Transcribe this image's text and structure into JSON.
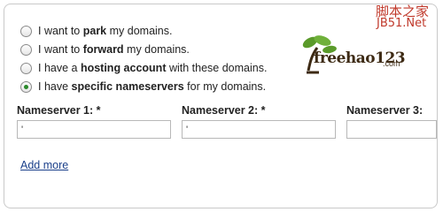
{
  "options": [
    {
      "prefix": "I want to ",
      "bold": "park",
      "suffix": " my domains.",
      "checked": false
    },
    {
      "prefix": "I want to ",
      "bold": "forward",
      "suffix": " my domains.",
      "checked": false
    },
    {
      "prefix": "I have a ",
      "bold": "hosting account",
      "suffix": " with these domains.",
      "checked": false
    },
    {
      "prefix": "I have ",
      "bold": "specific nameservers",
      "suffix": " for my domains.",
      "checked": true
    }
  ],
  "nameservers": [
    {
      "label": "Nameserver 1: *",
      "value": "'",
      "placeholder": ""
    },
    {
      "label": "Nameserver 2: *",
      "value": "'",
      "placeholder": ""
    },
    {
      "label": "Nameserver 3:",
      "value": "",
      "placeholder": ""
    }
  ],
  "add_more_label": "Add more",
  "logo": {
    "text": "freehao123",
    "sub": ".com",
    "accent": "#5a9a2a"
  },
  "watermark": {
    "line1": "脚本之家",
    "line2": "JB51.Net"
  },
  "colors": {
    "checked_dot": "#2b8a2b",
    "link": "#1a3f8a",
    "watermark": "#c0392b"
  }
}
